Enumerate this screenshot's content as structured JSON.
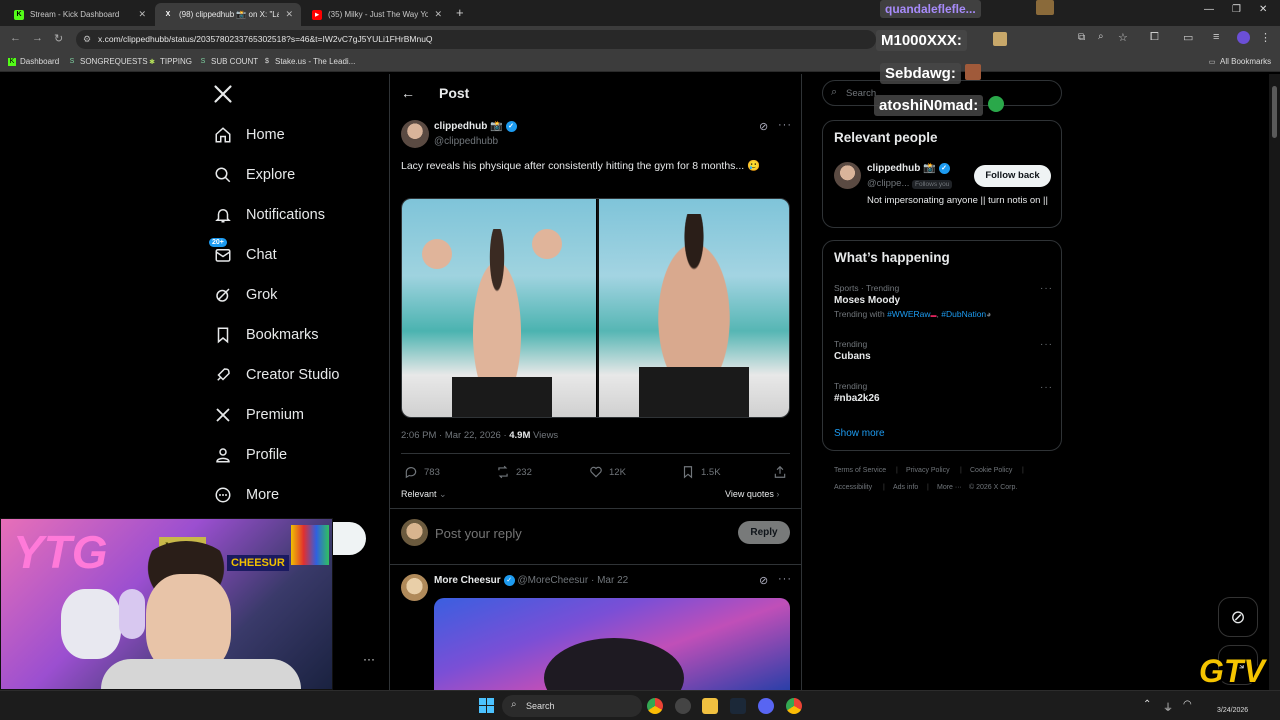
{
  "browser": {
    "tabs": [
      {
        "label": "Stream - Kick Dashboard",
        "fav_color": "#53fc18",
        "fav_text": "K"
      },
      {
        "label": "(98) clippedhub 📸 on X: \"Lacy",
        "fav_color": "#000000",
        "fav_text": "X"
      },
      {
        "label": "(35) Milky - Just The Way You A",
        "fav_color": "#ff0000",
        "fav_text": "▶"
      }
    ],
    "url": "x.com/clippedhubb/status/2035780233765302518?s=46&t=IW2vC7gJ5YULi1FHrBMnuQ",
    "bookmarks": [
      "Dashboard",
      "SONGREQUESTS",
      "TIPPING",
      "SUB COUNT",
      "Stake.us - The Leadi..."
    ],
    "all_bookmarks": "All Bookmarks"
  },
  "nav": {
    "items": [
      "Home",
      "Explore",
      "Notifications",
      "Chat",
      "Grok",
      "Bookmarks",
      "Creator Studio",
      "Premium",
      "Profile",
      "More"
    ],
    "chat_badge": "20+"
  },
  "post": {
    "header": "Post",
    "author": {
      "name": "clippedhub 📸",
      "handle": "@clippedhubb"
    },
    "text": "Lacy reveals his physique after consistently hitting the gym for 8 months... 🥲",
    "time": "2:06 PM · Mar 22, 2026 · ",
    "views_count": "4.9M",
    "views_label": " Views",
    "stats": {
      "replies": "783",
      "reposts": "232",
      "likes": "12K",
      "bookmarks": "1.5K"
    },
    "sort": "Relevant",
    "view_quotes": "View quotes",
    "reply_placeholder": "Post your reply",
    "reply_button": "Reply"
  },
  "next_post": {
    "name": "More Cheesur",
    "handle_time": "@MoreCheesur · Mar 22"
  },
  "right": {
    "search_placeholder": "Search",
    "relevant_title": "Relevant people",
    "person": {
      "name": "clippedhub 📸",
      "handle": "@clippe...",
      "follows_you": "Follows you",
      "bio": "Not impersonating anyone || turn notis on ||",
      "follow_button": "Follow back"
    },
    "happening_title": "What’s happening",
    "trends": [
      {
        "category": "Sports · Trending",
        "name": "Moses Moody",
        "trending_with_label": "Trending with ",
        "tags": [
          "#WWERaw",
          "#DubNation"
        ]
      },
      {
        "category": "Trending",
        "name": "Cubans"
      },
      {
        "category": "Trending",
        "name": "#nba2k26"
      }
    ],
    "show_more": "Show more",
    "footer": [
      "Terms of Service",
      "Privacy Policy",
      "Cookie Policy",
      "Accessibility",
      "Ads info",
      "More ···",
      "© 2026 X Corp."
    ]
  },
  "overlay": {
    "chat_names": [
      "quandaleflefle...",
      "M1000XXX:",
      "Sebdawg:",
      "atoshiN0mad:"
    ],
    "webcam_sign": "YTG",
    "webcam_banner": "CHEESUR",
    "logo": "GTV"
  },
  "taskbar": {
    "search": "Search",
    "date": "3/24/2026"
  },
  "colors": {
    "accent": "#1d9bf0",
    "background": "#000000",
    "border": "#2f3336",
    "muted": "#71767b"
  }
}
